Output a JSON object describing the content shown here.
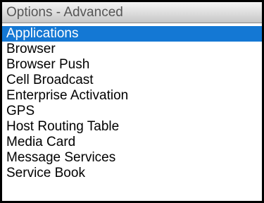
{
  "window": {
    "title": "Options - Advanced"
  },
  "menu": {
    "selected_index": 0,
    "items": [
      {
        "label": "Applications"
      },
      {
        "label": "Browser"
      },
      {
        "label": "Browser Push"
      },
      {
        "label": "Cell Broadcast"
      },
      {
        "label": "Enterprise Activation"
      },
      {
        "label": "GPS"
      },
      {
        "label": "Host Routing Table"
      },
      {
        "label": "Media Card"
      },
      {
        "label": "Message Services"
      },
      {
        "label": "Service Book"
      }
    ]
  },
  "colors": {
    "selection": "#1478d4",
    "title_text": "#555555",
    "frame": "#000000"
  }
}
